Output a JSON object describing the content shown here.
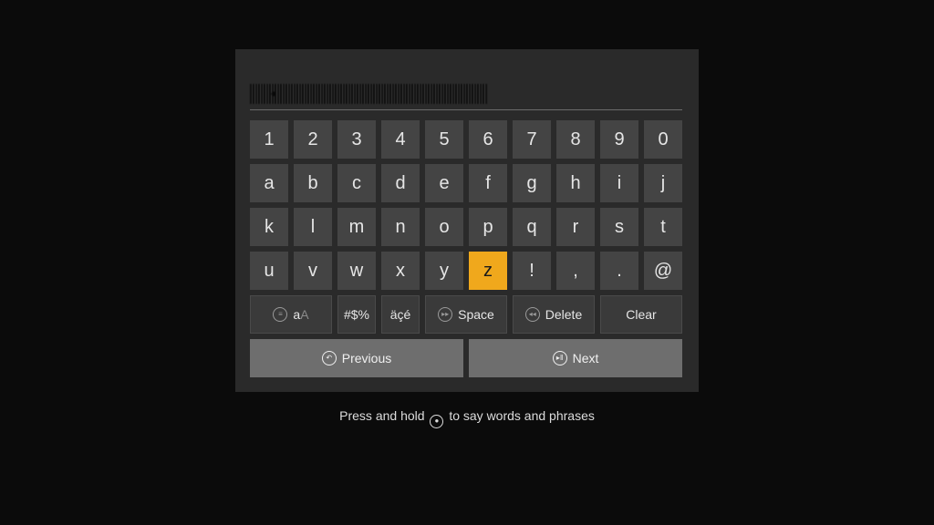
{
  "input": {
    "value": ""
  },
  "keyboard": {
    "rows": [
      [
        "1",
        "2",
        "3",
        "4",
        "5",
        "6",
        "7",
        "8",
        "9",
        "0"
      ],
      [
        "a",
        "b",
        "c",
        "d",
        "e",
        "f",
        "g",
        "h",
        "i",
        "j"
      ],
      [
        "k",
        "l",
        "m",
        "n",
        "o",
        "p",
        "q",
        "r",
        "s",
        "t"
      ],
      [
        "u",
        "v",
        "w",
        "x",
        "y",
        "z",
        "!",
        ",",
        ".",
        "@"
      ]
    ],
    "focused_key": "z",
    "caps_label_lower": "a",
    "caps_label_upper": "A",
    "symbols_label": "#$%",
    "accents_label": "äçé",
    "space_label": "Space",
    "delete_label": "Delete",
    "clear_label": "Clear",
    "previous_label": "Previous",
    "next_label": "Next"
  },
  "hint": {
    "before": "Press and hold",
    "after": "to say words and phrases"
  },
  "colors": {
    "focus": "#f0a81c",
    "key": "#444444",
    "panel": "#2a2a2a"
  },
  "icons": {
    "caps": "menu-icon",
    "space": "fast-forward-icon",
    "delete": "rewind-icon",
    "previous": "back-icon",
    "next": "play-pause-icon",
    "mic": "microphone-icon"
  }
}
